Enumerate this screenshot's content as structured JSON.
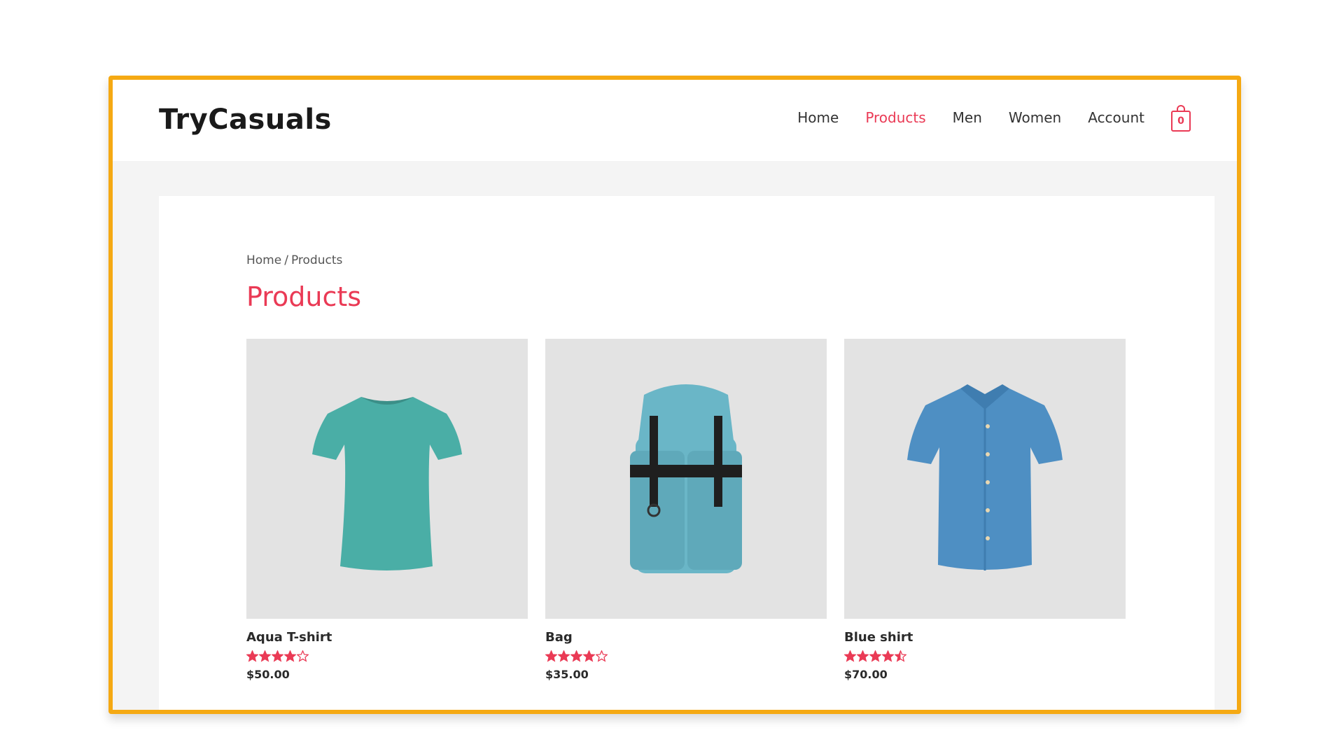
{
  "header": {
    "logo": "TryCasuals",
    "nav": [
      {
        "label": "Home",
        "active": false
      },
      {
        "label": "Products",
        "active": true
      },
      {
        "label": "Men",
        "active": false
      },
      {
        "label": "Women",
        "active": false
      },
      {
        "label": "Account",
        "active": false
      }
    ],
    "cart_count": "0"
  },
  "breadcrumb": {
    "home": "Home",
    "separator": "/",
    "current": "Products"
  },
  "page_title": "Products",
  "products": [
    {
      "name": "Aqua T-shirt",
      "price": "$50.00",
      "rating": 4,
      "image": "tshirt-icon"
    },
    {
      "name": "Bag",
      "price": "$35.00",
      "rating": 4,
      "image": "backpack-icon"
    },
    {
      "name": "Blue shirt",
      "price": "$70.00",
      "rating": 4.5,
      "image": "shirt-icon"
    }
  ],
  "colors": {
    "accent": "#ea3a55",
    "frame_border": "#f5a913",
    "tshirt": "#4aaea6",
    "backpack": "#6ab6c7",
    "shirt": "#4e8fc3"
  }
}
